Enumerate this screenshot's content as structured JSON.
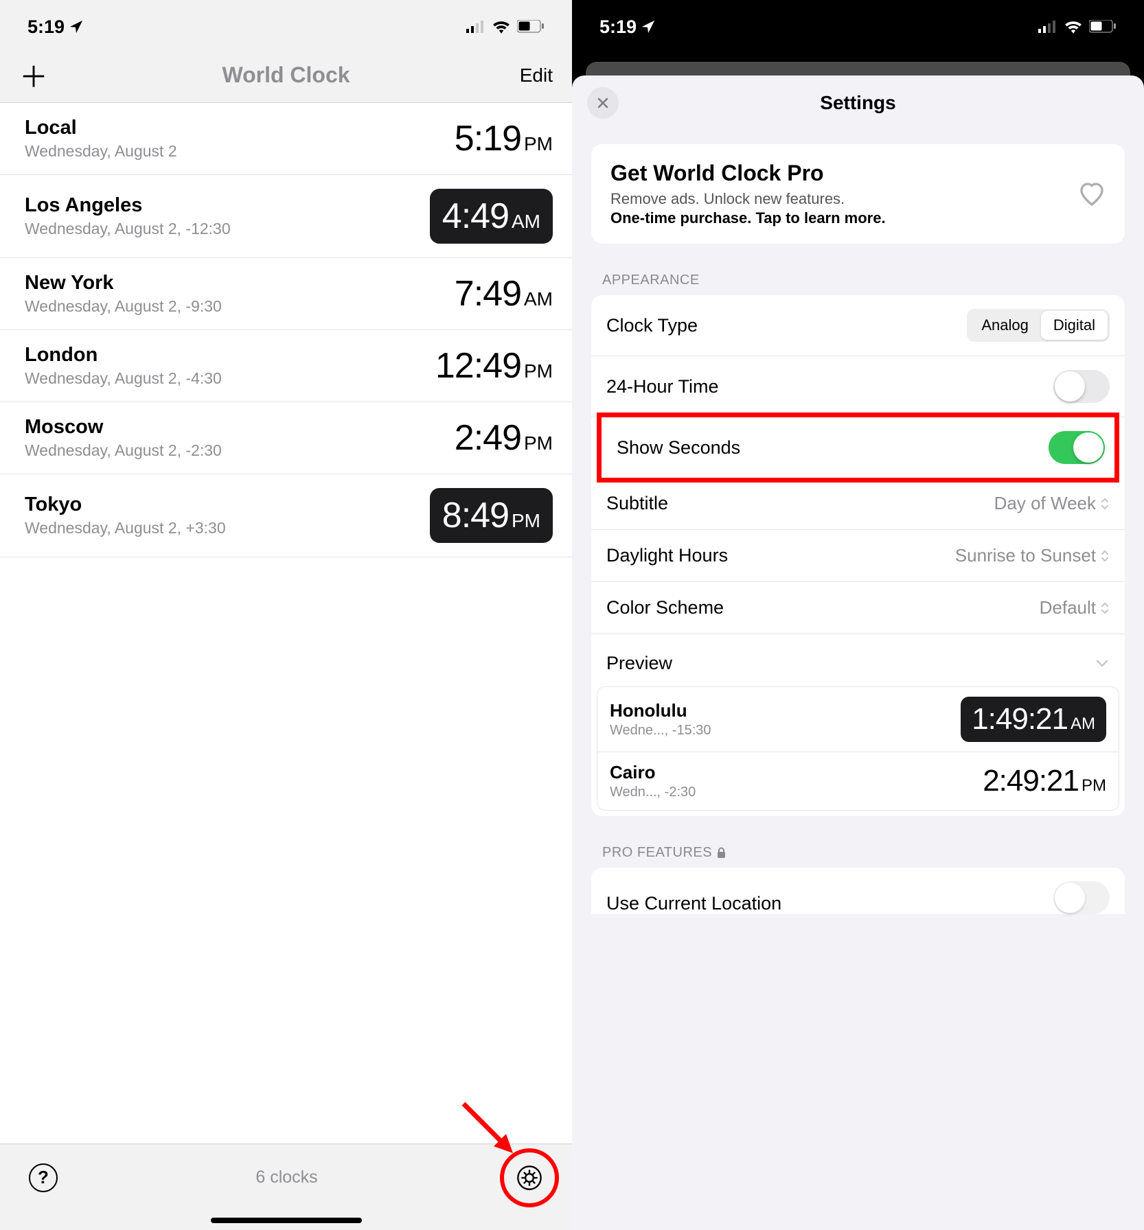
{
  "status": {
    "time": "5:19",
    "location_icon": "location-arrow"
  },
  "left": {
    "nav": {
      "title": "World Clock",
      "add": "＋",
      "edit": "Edit"
    },
    "clocks": [
      {
        "city": "Local",
        "sub": "Wednesday, August 2",
        "time": "5:19",
        "ampm": "PM",
        "dark": false
      },
      {
        "city": "Los Angeles",
        "sub": "Wednesday, August 2, -12:30",
        "time": "4:49",
        "ampm": "AM",
        "dark": true
      },
      {
        "city": "New York",
        "sub": "Wednesday, August 2, -9:30",
        "time": "7:49",
        "ampm": "AM",
        "dark": false
      },
      {
        "city": "London",
        "sub": "Wednesday, August 2, -4:30",
        "time": "12:49",
        "ampm": "PM",
        "dark": false
      },
      {
        "city": "Moscow",
        "sub": "Wednesday, August 2, -2:30",
        "time": "2:49",
        "ampm": "PM",
        "dark": false
      },
      {
        "city": "Tokyo",
        "sub": "Wednesday, August 2, +3:30",
        "time": "8:49",
        "ampm": "PM",
        "dark": true
      }
    ],
    "bottom": {
      "count": "6 clocks"
    }
  },
  "right": {
    "title": "Settings",
    "promo": {
      "title": "Get World Clock Pro",
      "line1": "Remove ads. Unlock new features.",
      "line2": "One-time purchase. Tap to learn more."
    },
    "section_appearance": "APPEARANCE",
    "section_pro": "PRO FEATURES",
    "rows": {
      "clock_type": {
        "label": "Clock Type",
        "opt1": "Analog",
        "opt2": "Digital"
      },
      "hour24": {
        "label": "24-Hour Time"
      },
      "seconds": {
        "label": "Show Seconds"
      },
      "subtitle": {
        "label": "Subtitle",
        "value": "Day of Week"
      },
      "daylight": {
        "label": "Daylight Hours",
        "value": "Sunrise to Sunset"
      },
      "color": {
        "label": "Color Scheme",
        "value": "Default"
      },
      "preview": {
        "label": "Preview"
      },
      "use_location": {
        "label": "Use Current Location"
      }
    },
    "preview": [
      {
        "city": "Honolulu",
        "sub": "Wedne..., -15:30",
        "time": "1:49:21",
        "ampm": "AM",
        "dark": true
      },
      {
        "city": "Cairo",
        "sub": "Wedn..., -2:30",
        "time": "2:49:21",
        "ampm": "PM",
        "dark": false
      }
    ]
  }
}
